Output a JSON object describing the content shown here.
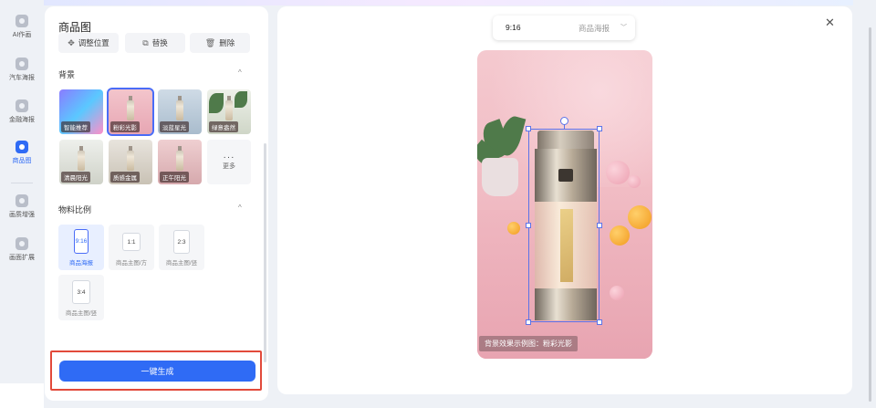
{
  "rail": {
    "items": [
      {
        "label": "AI作画"
      },
      {
        "label": "汽车海报"
      },
      {
        "label": "金融海报"
      },
      {
        "label": "商品图"
      },
      {
        "label": "画质增强"
      },
      {
        "label": "画面扩展"
      }
    ]
  },
  "panel": {
    "title": "商品图",
    "tools": {
      "adjust": "调整位置",
      "replace": "替换",
      "delete": "删除"
    },
    "background": {
      "title": "背景",
      "items": [
        {
          "label": "智能推荐"
        },
        {
          "label": "粉彩光影"
        },
        {
          "label": "淡蓝星光"
        },
        {
          "label": "绿意盎然"
        },
        {
          "label": "清晨阳光"
        },
        {
          "label": "质感金属"
        },
        {
          "label": "正午阳光"
        }
      ],
      "more": "更多"
    },
    "ratio": {
      "title": "物料比例",
      "items": [
        {
          "ratio": "9:16",
          "name": "商品海报"
        },
        {
          "ratio": "1:1",
          "name": "商品主图/方"
        },
        {
          "ratio": "2:3",
          "name": "商品主图/竖"
        },
        {
          "ratio": "3:4",
          "name": "商品主图/竖"
        }
      ]
    },
    "generate": "一键生成"
  },
  "preview": {
    "dropdown": {
      "value": "9:16",
      "name": "商品海报"
    },
    "caption": "背景效果示例图：粉彩光影"
  },
  "colors": {
    "accent": "#2f6bf5",
    "highlight_border": "#e24a3b"
  }
}
